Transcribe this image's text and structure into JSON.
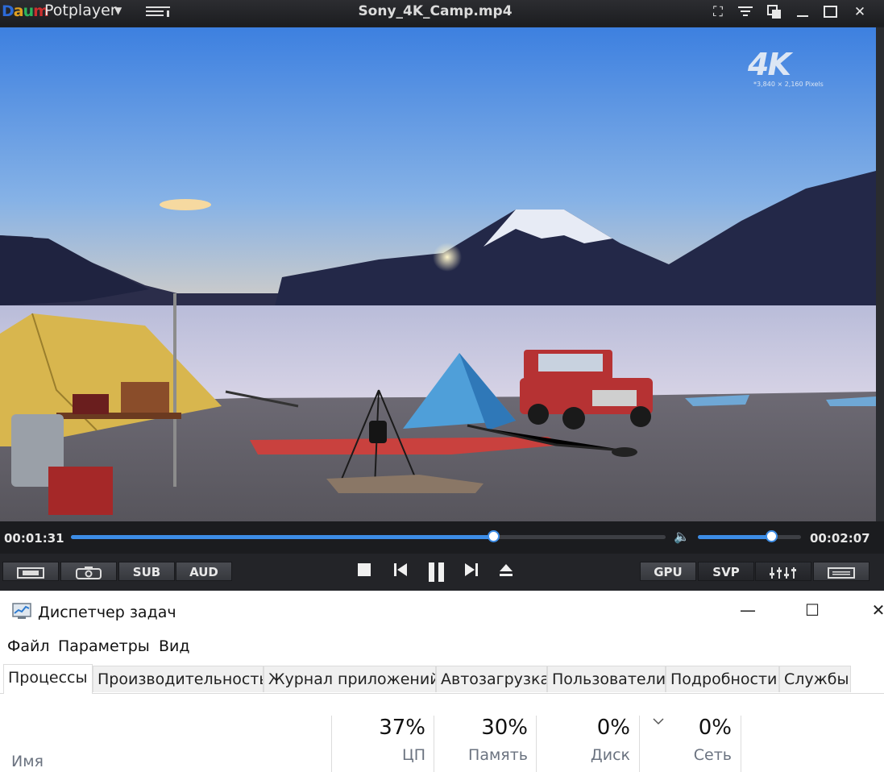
{
  "potplayer": {
    "logo": {
      "text": "Daum"
    },
    "app_name": "Potplayer",
    "file_title": "Sony_4K_Camp.mp4",
    "overlay_badge": "4K",
    "overlay_caption": "*3,840 × 2,160 Pixels",
    "time_elapsed": "00:01:31",
    "time_remaining": "00:02:07",
    "seek_progress": 0.71,
    "volume_level": 0.71,
    "left_buttons": [
      "",
      "",
      "SUB",
      "AUD"
    ],
    "right_buttons": [
      "GPU",
      "SVP",
      "",
      ""
    ],
    "colors": {
      "accent": "#3d8de6",
      "frame": "#1e1f22"
    }
  },
  "taskmanager": {
    "title": "Диспетчер задач",
    "menu": [
      "Файл",
      "Параметры",
      "Вид"
    ],
    "tabs": [
      "Процессы",
      "Производительность",
      "Журнал приложений",
      "Автозагрузка",
      "Пользователи",
      "Подробности",
      "Службы"
    ],
    "selected_tab": "Процессы",
    "columns": {
      "name_label": "Имя",
      "cpu": {
        "value": "37%",
        "label": "ЦП"
      },
      "memory": {
        "value": "30%",
        "label": "Память"
      },
      "disk": {
        "value": "0%",
        "label": "Диск"
      },
      "network": {
        "value": "0%",
        "label": "Сеть"
      }
    }
  }
}
